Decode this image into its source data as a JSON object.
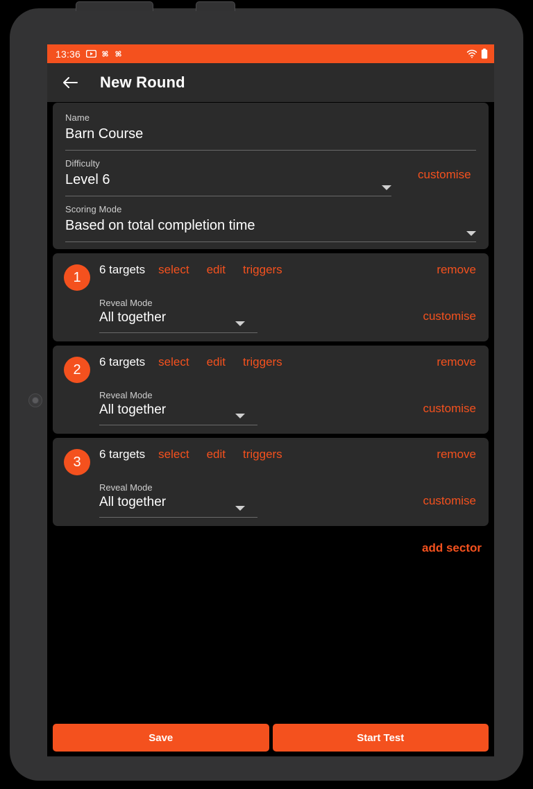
{
  "status_bar": {
    "clock": "13:36",
    "left_icons": [
      "youtube-icon",
      "pinwheel-icon",
      "pinwheel-icon"
    ],
    "right_icons": [
      "wifi-icon",
      "battery-icon"
    ],
    "background_color": "#f4511e"
  },
  "app_bar": {
    "back_icon": "back-arrow-icon",
    "title": "New Round"
  },
  "details": {
    "name": {
      "label": "Name",
      "value": "Barn Course"
    },
    "difficulty": {
      "label": "Difficulty",
      "value": "Level 6",
      "customise_label": "customise"
    },
    "scoring_mode": {
      "label": "Scoring Mode",
      "value": "Based on total completion time"
    }
  },
  "sectors": [
    {
      "number": "1",
      "targets": "6 targets",
      "select_label": "select",
      "edit_label": "edit",
      "triggers_label": "triggers",
      "remove_label": "remove",
      "reveal_label": "Reveal Mode",
      "reveal_value": "All together",
      "customise_label": "customise"
    },
    {
      "number": "2",
      "targets": "6 targets",
      "select_label": "select",
      "edit_label": "edit",
      "triggers_label": "triggers",
      "remove_label": "remove",
      "reveal_label": "Reveal Mode",
      "reveal_value": "All together",
      "customise_label": "customise"
    },
    {
      "number": "3",
      "targets": "6 targets",
      "select_label": "select",
      "edit_label": "edit",
      "triggers_label": "triggers",
      "remove_label": "remove",
      "reveal_label": "Reveal Mode",
      "reveal_value": "All together",
      "customise_label": "customise"
    }
  ],
  "add_sector_label": "add sector",
  "bottom_bar": {
    "save_label": "Save",
    "start_test_label": "Start Test"
  },
  "colors": {
    "accent": "#f4511e",
    "card": "#2b2b2b",
    "screen_background": "#000000"
  }
}
